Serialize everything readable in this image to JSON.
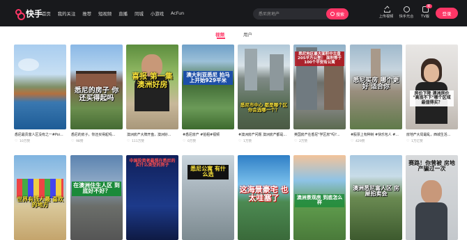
{
  "app": {
    "name": "快手"
  },
  "nav": [
    "首页",
    "我的关注",
    "推荐",
    "短视频",
    "直播",
    "同城",
    "小游戏",
    "AcFun"
  ],
  "search": {
    "placeholder": "悉尼房地产",
    "button": "搜索"
  },
  "toolbar": {
    "upload": "上传视频",
    "creator": "快手光合",
    "tv": "TV版",
    "tv_badge": "新",
    "login": "登录"
  },
  "tabs": {
    "video": "视频",
    "user": "用户"
  },
  "colors": {
    "accent": "#fe3666",
    "topbar": "#18191c"
  },
  "cards": [
    {
      "caption": "悉尼最贵富人区没有之一#Poi...",
      "likes": "10万赞",
      "overlay": ""
    },
    {
      "caption": "悉尼的房子，你还买得起吗...",
      "likes": "98赞",
      "overlay": "悉尼的房子 你还买得起吗"
    },
    {
      "caption": "澳洲房产大牌开盘，澳洲好...",
      "likes": "111万赞",
      "overlay": "喜报 第一集 澳洲好房"
    },
    {
      "caption": "#悉尼房产 #拍租#视频",
      "likes": "0万赞",
      "overlay": "澳大利亚悉尼 拍马上开始929平米"
    },
    {
      "caption": "#澳洲房产问题 澳洲房产都是...",
      "likes": "1万赞",
      "overlay": "悉尼市中心 都是哪个区 你会选哪一个？"
    },
    {
      "caption": "英国房产在悉尼\"学区房\"吗?...",
      "likes": "2万赞",
      "overlay": "悉尼地区最大面积中古盘 205平方公里！ 面积等于100个平安有公寓"
    },
    {
      "caption": "#股票上有种树 #快乐包人 #...",
      "likes": "429赞",
      "overlay": "悉尼买房 哪个更好 适合你"
    },
    {
      "caption": "房地产大局最乱，西城生活...",
      "likes": "1万亿赞",
      "overlay": "房价下降 澳洲房价 \"高涨不下\"哪个区域最值得买？"
    },
    {
      "caption": "",
      "likes": "",
      "overlay": "世界有钱人最 喜欢的地方"
    },
    {
      "caption": "",
      "likes": "",
      "overlay": "在澳洲住生人区 到底好不好？"
    },
    {
      "caption": "",
      "likes": "",
      "overlay": "中国投资者最想在悉尼的 买什么类型的房子"
    },
    {
      "caption": "",
      "likes": "",
      "overlay": "悉尼公寓 有什么选"
    },
    {
      "caption": "",
      "likes": "",
      "overlay": "这海景豪宅 也太哇塞了"
    },
    {
      "caption": "",
      "likes": "",
      "overlay": "澳洲景观房 到底怎么样"
    },
    {
      "caption": "",
      "likes": "",
      "overlay": "澳洲悉尼富人区 房屋拍卖会"
    },
    {
      "caption": "",
      "likes": "",
      "overlay": "赛路！你曾被 房地产骗过一次"
    }
  ]
}
